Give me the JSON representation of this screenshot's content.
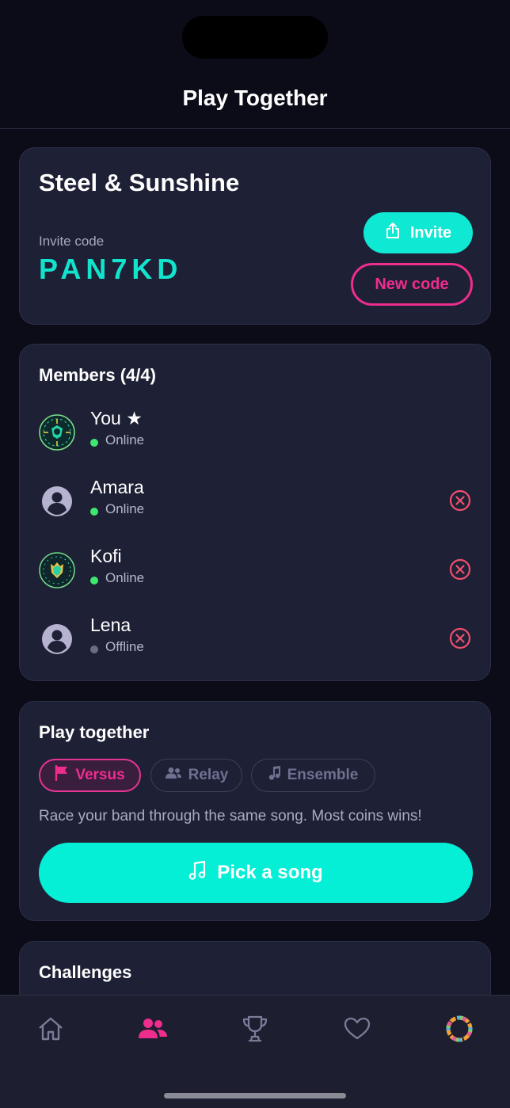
{
  "header": {
    "title": "Play Together"
  },
  "band": {
    "name": "Steel & Sunshine",
    "invite_label": "Invite code",
    "invite_code": "PAN7KD",
    "invite_button": "Invite",
    "new_code_button": "New code"
  },
  "members": {
    "title": "Members (4/4)",
    "list": [
      {
        "name": "You ★",
        "status": "Online",
        "online": true,
        "avatar": "sun-crest-icon",
        "removable": false
      },
      {
        "name": "Amara",
        "status": "Online",
        "online": true,
        "avatar": "person-icon",
        "removable": true
      },
      {
        "name": "Kofi",
        "status": "Online",
        "online": true,
        "avatar": "lion-crest-icon",
        "removable": true
      },
      {
        "name": "Lena",
        "status": "Offline",
        "online": false,
        "avatar": "person-icon",
        "removable": true
      }
    ]
  },
  "play": {
    "title": "Play together",
    "modes": [
      {
        "label": "Versus",
        "icon": "flag-icon",
        "selected": true
      },
      {
        "label": "Relay",
        "icon": "people-icon",
        "selected": false
      },
      {
        "label": "Ensemble",
        "icon": "music-note-icon",
        "selected": false
      }
    ],
    "description": "Race your band through the same song. Most coins wins!",
    "pick_button": "Pick a song"
  },
  "challenges": {
    "title": "Challenges"
  },
  "tabs": [
    {
      "name": "home-icon",
      "active": false
    },
    {
      "name": "band-icon",
      "active": true
    },
    {
      "name": "trophy-icon",
      "active": false
    },
    {
      "name": "heart-icon",
      "active": false
    },
    {
      "name": "profile-ring-icon",
      "active": false
    }
  ],
  "colors": {
    "accent": "#0fe8d2",
    "pink": "#ee2d8d",
    "online": "#3ee86f",
    "offline": "#6b6d85",
    "remove": "#f0506e"
  }
}
